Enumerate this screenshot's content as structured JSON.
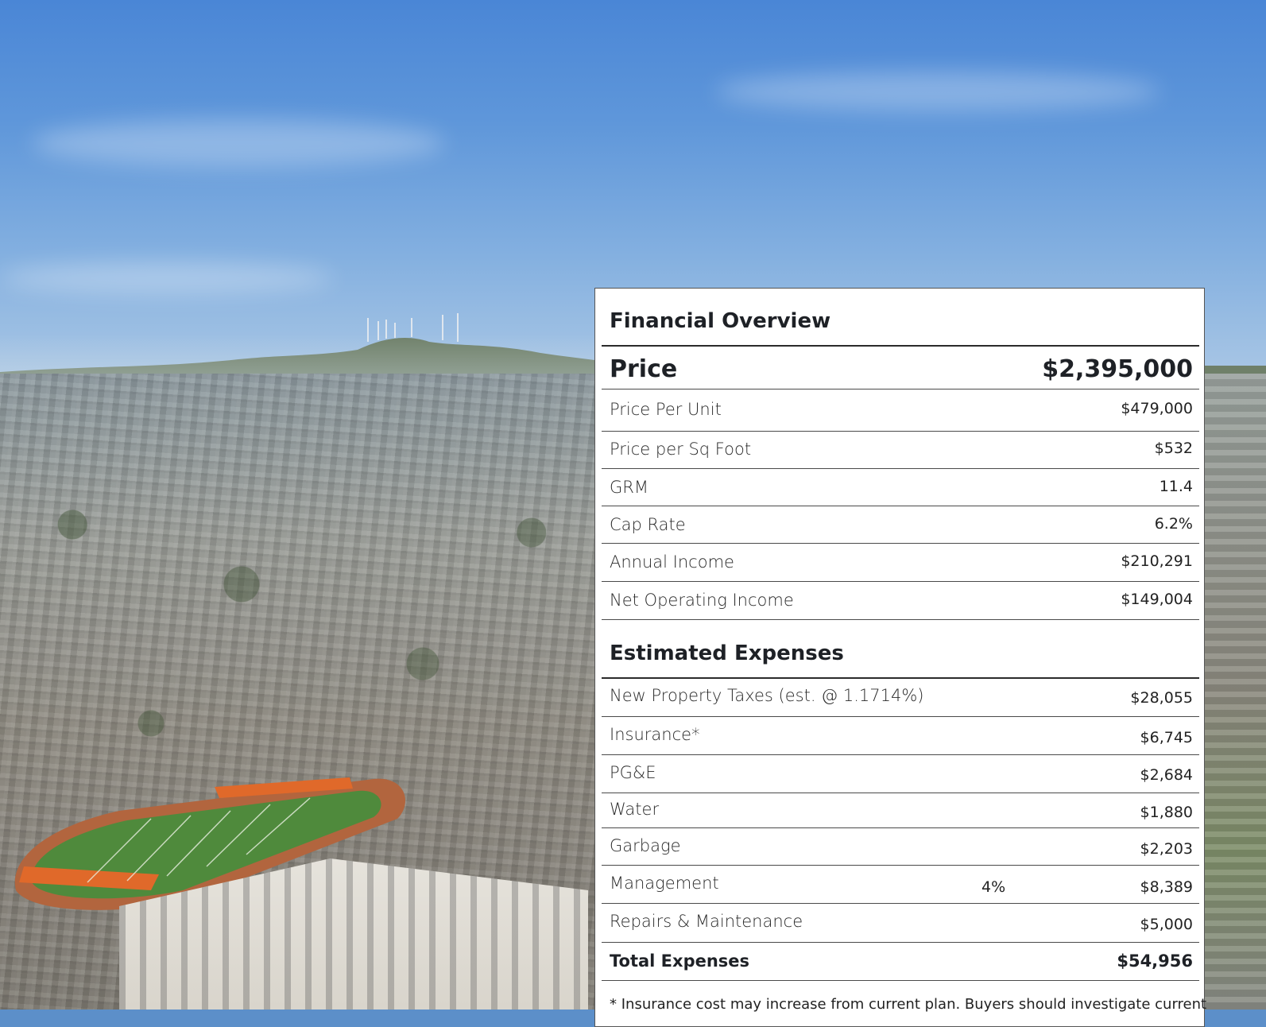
{
  "financial_overview": {
    "title": "Financial Overview",
    "price_label": "Price",
    "price_value": "$2,395,000",
    "rows": [
      {
        "label": "Price Per Unit",
        "value": "$479,000"
      },
      {
        "label": "Price per Sq Foot",
        "value": "$532"
      },
      {
        "label": "GRM",
        "value": "11.4"
      },
      {
        "label": "Cap Rate",
        "value": "6.2%"
      },
      {
        "label": "Annual Income",
        "value": "$210,291"
      },
      {
        "label": "Net Operating Income",
        "value": "$149,004"
      }
    ]
  },
  "estimated_expenses": {
    "title": "Estimated Expenses",
    "rows": [
      {
        "label": "New Property Taxes (est. @ 1.1714%)",
        "value": "$28,055"
      },
      {
        "label": "Insurance*",
        "value": "$6,745"
      },
      {
        "label": "PG&E",
        "value": "$2,684"
      },
      {
        "label": "Water",
        "value": "$1,880"
      },
      {
        "label": "Garbage",
        "value": "$2,203"
      },
      {
        "label": "Management",
        "percent": "4%",
        "value": "$8,389"
      },
      {
        "label": "Repairs & Maintenance",
        "value": "$5,000"
      }
    ],
    "total_label": "Total Expenses",
    "total_value": "$54,956",
    "footnote": "* Insurance cost may increase from current plan. Buyers should investigate current"
  }
}
